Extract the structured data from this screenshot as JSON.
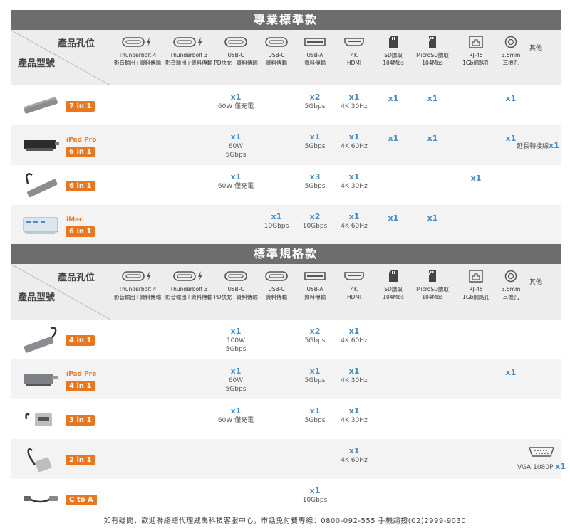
{
  "sections": [
    {
      "title": "專業標準款",
      "rows": [
        {
          "badge": "7 in 1",
          "model": "",
          "cells": [
            {
              "col": "usbc",
              "count": "x1",
              "note": "60W 僅充電"
            },
            {
              "col": "usba",
              "count": "x2",
              "note": "5Gbps"
            },
            {
              "col": "hdmi",
              "count": "x1",
              "note": "4K 30Hz"
            },
            {
              "col": "sd",
              "count": "x1",
              "note": ""
            },
            {
              "col": "msd",
              "count": "x1",
              "note": ""
            },
            {
              "col": "audio",
              "count": "x1",
              "note": ""
            }
          ]
        },
        {
          "badge": "6 in 1",
          "model": "iPad Pro",
          "cells": [
            {
              "col": "usbc",
              "count": "x1",
              "note": "60W\n5Gbps"
            },
            {
              "col": "usba",
              "count": "x1",
              "note": "5Gbps"
            },
            {
              "col": "hdmi",
              "count": "x1",
              "note": "4K 60Hz"
            },
            {
              "col": "sd",
              "count": "x1",
              "note": ""
            },
            {
              "col": "msd",
              "count": "x1",
              "note": ""
            },
            {
              "col": "audio",
              "count": "x1",
              "note": ""
            }
          ],
          "other": "延長轉接線",
          "other_count": "x1"
        },
        {
          "badge": "6 in 1",
          "model": "",
          "cells": [
            {
              "col": "usbc",
              "count": "x1",
              "note": "60W 僅充電"
            },
            {
              "col": "usba",
              "count": "x3",
              "note": "5Gbps"
            },
            {
              "col": "hdmi",
              "count": "x1",
              "note": "4K 30Hz"
            },
            {
              "col": "rj45",
              "count": "x1",
              "note": ""
            }
          ]
        },
        {
          "badge": "6 in 1",
          "model": "iMac",
          "cells": [
            {
              "col": "usbc2",
              "count": "x1",
              "note": "10Gbps"
            },
            {
              "col": "usba",
              "count": "x2",
              "note": "10Gbps"
            },
            {
              "col": "hdmi",
              "count": "x1",
              "note": "4K 60Hz"
            },
            {
              "col": "sd",
              "count": "x1",
              "note": ""
            },
            {
              "col": "msd",
              "count": "x1",
              "note": ""
            }
          ]
        }
      ]
    },
    {
      "title": "標準規格款",
      "rows": [
        {
          "badge": "4 in 1",
          "model": "",
          "cells": [
            {
              "col": "usbc",
              "count": "x1",
              "note": "100W\n5Gbps"
            },
            {
              "col": "usba",
              "count": "x2",
              "note": "5Gbps"
            },
            {
              "col": "hdmi",
              "count": "x1",
              "note": "4K 60Hz"
            }
          ]
        },
        {
          "badge": "4 in 1",
          "model": "iPad Pro",
          "cells": [
            {
              "col": "usbc",
              "count": "x1",
              "note": "60W\n5Gbps"
            },
            {
              "col": "usba",
              "count": "x1",
              "note": "5Gbps"
            },
            {
              "col": "hdmi",
              "count": "x1",
              "note": "4K 30Hz"
            },
            {
              "col": "audio",
              "count": "x1",
              "note": ""
            }
          ]
        },
        {
          "badge": "3 in 1",
          "model": "",
          "cells": [
            {
              "col": "usbc",
              "count": "x1",
              "note": "60W 僅充電"
            },
            {
              "col": "usba",
              "count": "x1",
              "note": "5Gbps"
            },
            {
              "col": "hdmi",
              "count": "x1",
              "note": "4K 30Hz"
            }
          ]
        },
        {
          "badge": "2 in 1",
          "model": "",
          "cells": [
            {
              "col": "hdmi",
              "count": "x1",
              "note": "4K 60Hz"
            }
          ],
          "other": "VGA 1080P",
          "other_count": "x1",
          "other_icon": true
        },
        {
          "badge": "C to A",
          "model": "",
          "cells": [
            {
              "col": "usba",
              "count": "x1",
              "note": "10Gbps"
            }
          ]
        }
      ]
    }
  ],
  "header": {
    "port_label": "產品孔位",
    "model_label": "產品型號",
    "other_label": "其他",
    "columns": [
      {
        "key": "tb4",
        "name1": "Thunderbolt 4",
        "name2": "影音輸出+資料傳輸",
        "icon": "thunderbolt-icon"
      },
      {
        "key": "tb3",
        "name1": "Thunderbolt 3",
        "name2": "影音輸出+資料傳輸",
        "icon": "thunderbolt-icon"
      },
      {
        "key": "usbc",
        "name1": "USB-C",
        "name2": "PD快充+資料傳輸",
        "icon": "usb-c-icon"
      },
      {
        "key": "usbc2",
        "name1": "USB-C",
        "name2": "資料傳輸",
        "icon": "usb-c-icon"
      },
      {
        "key": "usba",
        "name1": "USB-A",
        "name2": "資料傳輸",
        "icon": "usb-a-icon"
      },
      {
        "key": "hdmi",
        "name1": "4K",
        "name2": "HDMI",
        "icon": "hdmi-icon"
      },
      {
        "key": "sd",
        "name1": "SD讀取",
        "name2": "104Mbs",
        "icon": "sd-card-icon"
      },
      {
        "key": "msd",
        "name1": "MicroSD讀取",
        "name2": "104Mbs",
        "icon": "microsd-icon"
      },
      {
        "key": "rj45",
        "name1": "RJ-45",
        "name2": "1Gb網路孔",
        "icon": "ethernet-icon"
      },
      {
        "key": "audio",
        "name1": "3.5mm",
        "name2": "耳機孔",
        "icon": "audio-jack-icon"
      }
    ]
  },
  "footer": "如有疑問，歡迎聯絡總代理威禹科技客服中心，市話免付費專線：0800-092-555 手機請撥(02)2999-9030",
  "colors": {
    "accent": "#e87722",
    "count": "#4a8cc0",
    "banner": "#6d6d6d"
  }
}
